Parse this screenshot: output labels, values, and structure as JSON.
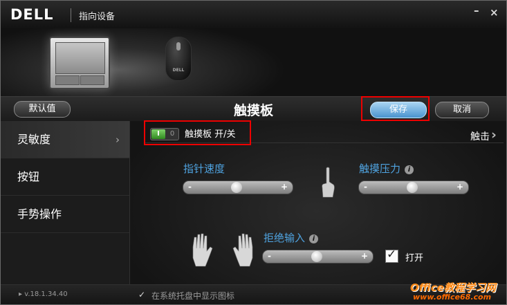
{
  "window": {
    "brand_logo": "DELL",
    "title": "指向设备",
    "minimize_glyph": "–",
    "close_glyph": "×"
  },
  "hero": {
    "devices": [
      {
        "name": "touchpad",
        "icon": "touchpad-icon"
      },
      {
        "name": "mouse",
        "icon": "mouse-icon",
        "brand": "DELL"
      }
    ]
  },
  "header": {
    "default_label": "默认值",
    "page_title": "触摸板",
    "save_label": "保存",
    "cancel_label": "取消"
  },
  "sidebar": {
    "items": [
      {
        "label": "灵敏度",
        "active": true,
        "chevron": "›"
      },
      {
        "label": "按钮",
        "active": false
      },
      {
        "label": "手势操作",
        "active": false
      }
    ]
  },
  "main": {
    "toggle": {
      "on_text": "I",
      "off_text": "0",
      "label": "触摸板 开/关",
      "state": "on"
    },
    "tap_link": "触击",
    "tap_chevron": "›",
    "pointer_speed": {
      "label": "指针速度",
      "minus": "-",
      "plus": "+",
      "value_fraction": 0.49
    },
    "touch_pressure": {
      "label": "触摸压力",
      "info": "i",
      "minus": "-",
      "plus": "+",
      "value_fraction": 0.49
    },
    "palm_rejection": {
      "label": "拒绝输入",
      "info": "i",
      "minus": "-",
      "plus": "+",
      "value_fraction": 0.49
    },
    "enable": {
      "label": "打开",
      "checked": true,
      "check_glyph": "✓"
    }
  },
  "status": {
    "version": "v.18.1.34.40",
    "tray_check_glyph": "✓",
    "tray_label": "在系统托盘中显示图标",
    "tray_checked": true
  },
  "watermark": {
    "top": "Office教程学习网",
    "bottom": "www.office68.com"
  },
  "colors": {
    "accent_blue": "#4fa3e0",
    "save_button": "#4a94cf",
    "highlight_red": "#ee0000",
    "toggle_green": "#2f8a1f"
  }
}
